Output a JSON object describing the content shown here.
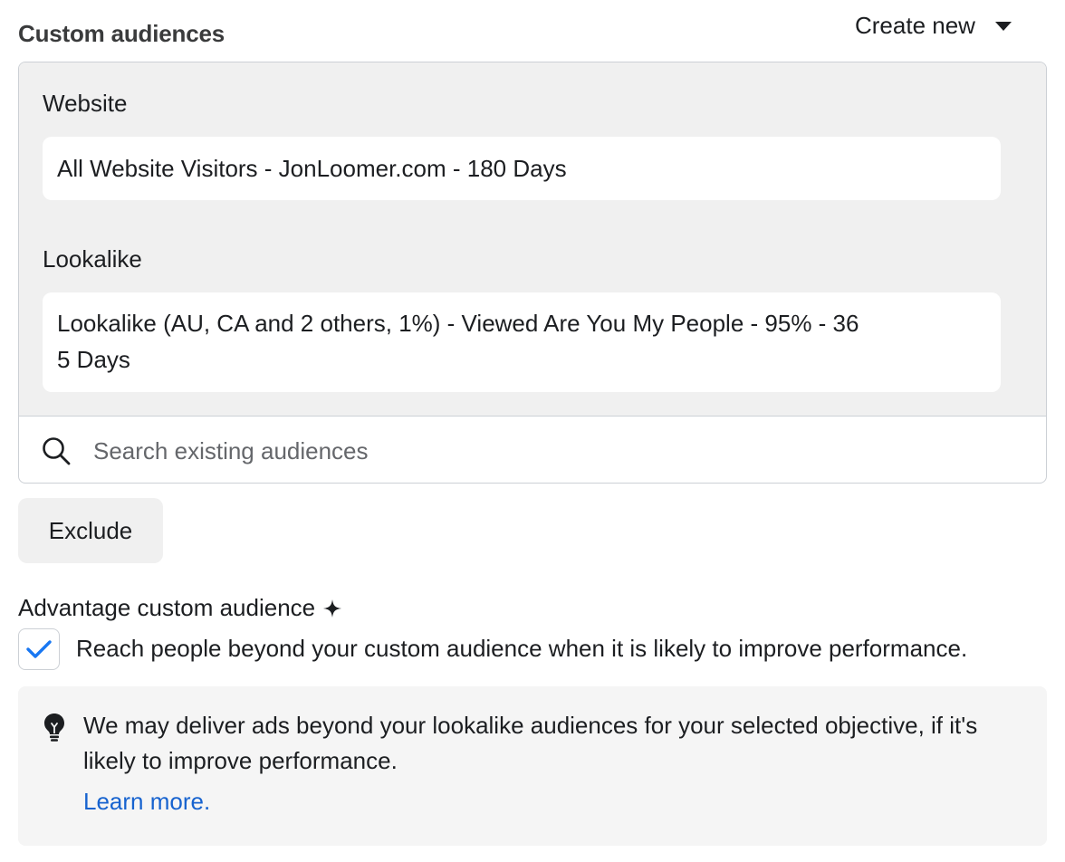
{
  "header": {
    "title": "Custom audiences",
    "create_new_label": "Create new",
    "create_new_icon": "caret-down-icon"
  },
  "audiences": {
    "groups": [
      {
        "label": "Website",
        "item": "All Website Visitors - JonLoomer.com - 180 Days"
      },
      {
        "label": "Lookalike",
        "item_line1": "Lookalike (AU, CA and 2 others, 1%) - Viewed Are You My People - 95% - 36",
        "item_line2": "5 Days"
      }
    ],
    "search": {
      "placeholder": "Search existing audiences",
      "value": "",
      "icon": "search-icon"
    }
  },
  "exclude_label": "Exclude",
  "advantage": {
    "title": "Advantage custom audience",
    "title_icon": "sparkle-icon",
    "checkbox_checked": true,
    "checkbox_label": "Reach people beyond your custom audience when it is likely to improve performance."
  },
  "info": {
    "icon": "lightbulb-icon",
    "text": "We may deliver ads beyond your lookalike audiences for your selected objective, if it's likely to improve performance.",
    "link_label": "Learn more."
  },
  "colors": {
    "accent": "#1763cf",
    "check": "#1877f2",
    "panel_bg": "#f0f0f0",
    "border": "#ccd0d5"
  }
}
